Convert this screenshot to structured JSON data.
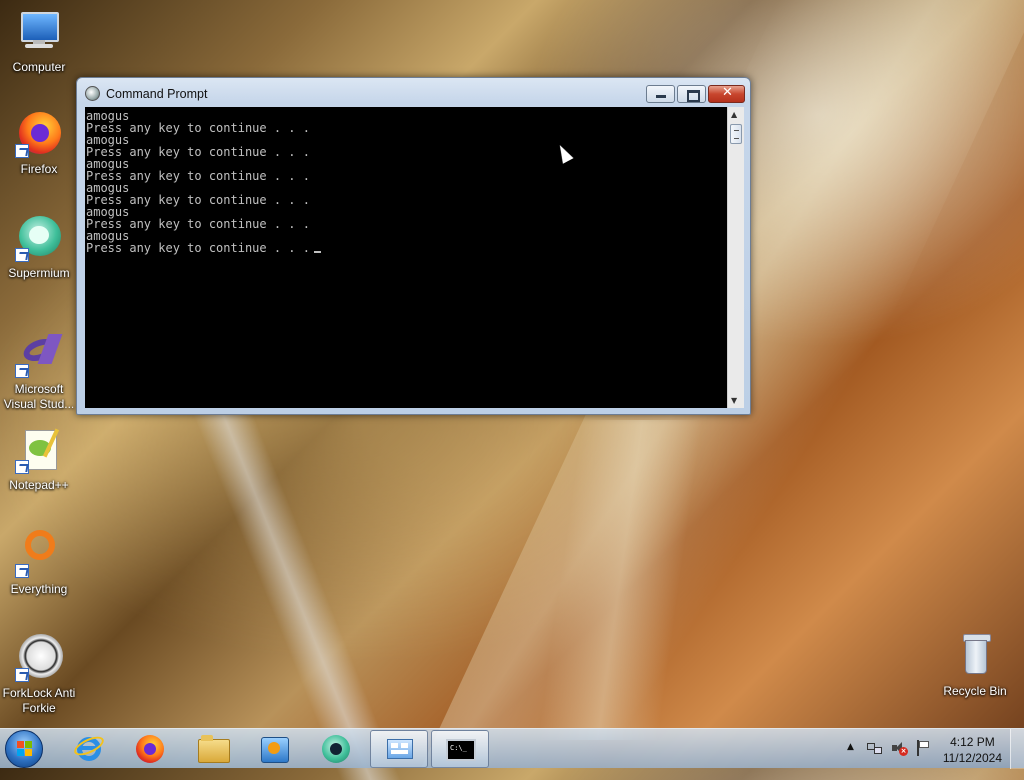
{
  "desktop": {
    "icons": [
      {
        "label": "Computer",
        "icon": "computer-icon"
      },
      {
        "label": "Firefox",
        "icon": "firefox-icon"
      },
      {
        "label": "Supermium",
        "icon": "supermium-icon"
      },
      {
        "label": "Microsoft Visual Stud...",
        "icon": "visual-studio-icon"
      },
      {
        "label": "Notepad++",
        "icon": "notepadpp-icon"
      },
      {
        "label": "Everything",
        "icon": "everything-icon"
      },
      {
        "label": "ForkLock Anti Forkie",
        "icon": "forklock-icon"
      },
      {
        "label": "Recycle Bin",
        "icon": "recycle-bin-icon"
      }
    ]
  },
  "window": {
    "title": "Command Prompt",
    "console_lines": [
      "amogus",
      "Press any key to continue . . .",
      "amogus",
      "Press any key to continue . . .",
      "amogus",
      "Press any key to continue . . .",
      "amogus",
      "Press any key to continue . . .",
      "amogus",
      "Press any key to continue . . .",
      "amogus",
      "Press any key to continue . . ."
    ],
    "colors": {
      "console_bg": "#000000",
      "console_text": "#c0c0c0",
      "close_button": "#c8462e"
    }
  },
  "taskbar": {
    "pinned": [
      {
        "icon": "internet-explorer-icon"
      },
      {
        "icon": "firefox-icon"
      },
      {
        "icon": "file-explorer-icon"
      },
      {
        "icon": "media-player-icon"
      },
      {
        "icon": "supermium-icon"
      },
      {
        "icon": "control-panel-icon"
      },
      {
        "icon": "command-prompt-icon"
      }
    ],
    "clock_time": "4:12 PM",
    "clock_date": "11/12/2024"
  }
}
